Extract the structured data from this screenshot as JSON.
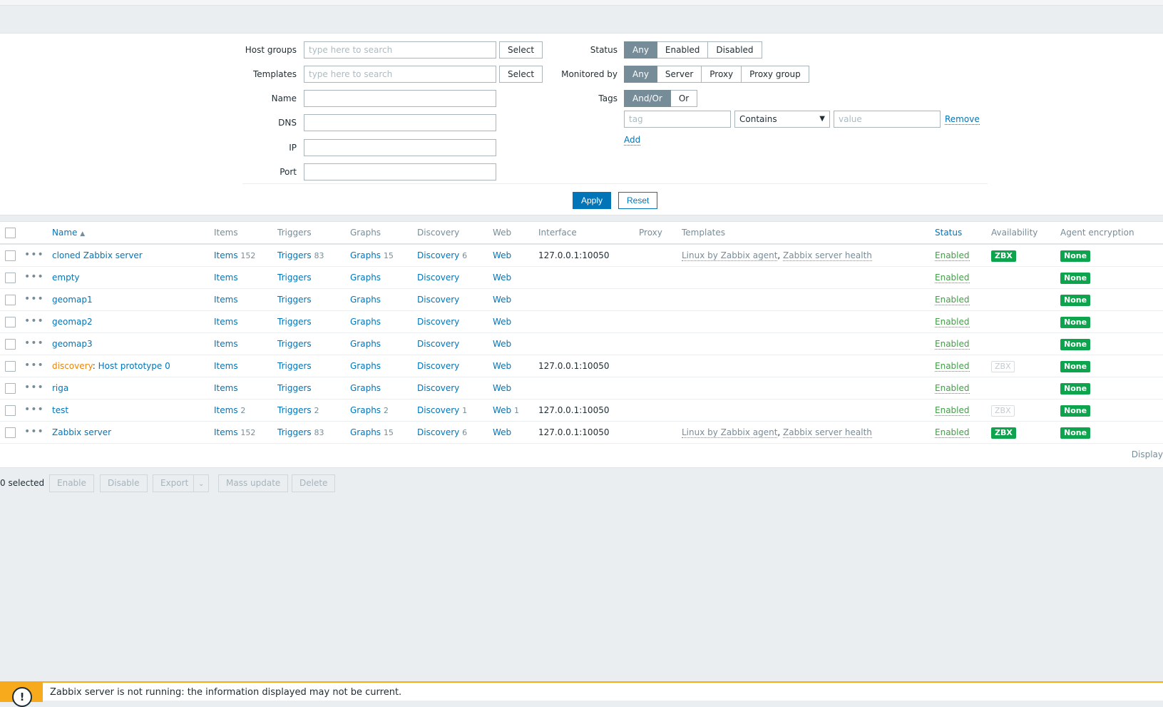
{
  "filter": {
    "host_groups_label": "Host groups",
    "host_groups_placeholder": "type here to search",
    "templates_label": "Templates",
    "templates_placeholder": "type here to search",
    "select_label": "Select",
    "name_label": "Name",
    "dns_label": "DNS",
    "ip_label": "IP",
    "port_label": "Port",
    "status_label": "Status",
    "status_options": [
      "Any",
      "Enabled",
      "Disabled"
    ],
    "monitored_label": "Monitored by",
    "monitored_options": [
      "Any",
      "Server",
      "Proxy",
      "Proxy group"
    ],
    "tags_label": "Tags",
    "tags_options": [
      "And/Or",
      "Or"
    ],
    "tag_placeholder": "tag",
    "operator_value": "Contains",
    "value_placeholder": "value",
    "remove_label": "Remove",
    "add_label": "Add",
    "apply_label": "Apply",
    "reset_label": "Reset"
  },
  "table": {
    "headers": {
      "name": "Name",
      "items": "Items",
      "triggers": "Triggers",
      "graphs": "Graphs",
      "discovery": "Discovery",
      "web": "Web",
      "interface": "Interface",
      "proxy": "Proxy",
      "templates": "Templates",
      "status": "Status",
      "availability": "Availability",
      "encryption": "Agent encryption"
    },
    "rows": [
      {
        "prefix": "",
        "name": "cloned Zabbix server",
        "items": "Items",
        "items_count": "152",
        "triggers": "Triggers",
        "triggers_count": "83",
        "graphs": "Graphs",
        "graphs_count": "15",
        "discovery": "Discovery",
        "discovery_count": "6",
        "web": "Web",
        "web_count": "",
        "interface": "127.0.0.1:10050",
        "tpl1": "Linux by Zabbix agent",
        "tpl2": "Zabbix server health",
        "status": "Enabled",
        "avail": "ZBX",
        "avail_state": "green",
        "enc": "None"
      },
      {
        "prefix": "",
        "name": "empty",
        "items": "Items",
        "items_count": "",
        "triggers": "Triggers",
        "triggers_count": "",
        "graphs": "Graphs",
        "graphs_count": "",
        "discovery": "Discovery",
        "discovery_count": "",
        "web": "Web",
        "web_count": "",
        "interface": "",
        "tpl1": "",
        "tpl2": "",
        "status": "Enabled",
        "avail": "",
        "avail_state": "",
        "enc": "None"
      },
      {
        "prefix": "",
        "name": "geomap1",
        "items": "Items",
        "items_count": "",
        "triggers": "Triggers",
        "triggers_count": "",
        "graphs": "Graphs",
        "graphs_count": "",
        "discovery": "Discovery",
        "discovery_count": "",
        "web": "Web",
        "web_count": "",
        "interface": "",
        "tpl1": "",
        "tpl2": "",
        "status": "Enabled",
        "avail": "",
        "avail_state": "",
        "enc": "None"
      },
      {
        "prefix": "",
        "name": "geomap2",
        "items": "Items",
        "items_count": "",
        "triggers": "Triggers",
        "triggers_count": "",
        "graphs": "Graphs",
        "graphs_count": "",
        "discovery": "Discovery",
        "discovery_count": "",
        "web": "Web",
        "web_count": "",
        "interface": "",
        "tpl1": "",
        "tpl2": "",
        "status": "Enabled",
        "avail": "",
        "avail_state": "",
        "enc": "None"
      },
      {
        "prefix": "",
        "name": "geomap3",
        "items": "Items",
        "items_count": "",
        "triggers": "Triggers",
        "triggers_count": "",
        "graphs": "Graphs",
        "graphs_count": "",
        "discovery": "Discovery",
        "discovery_count": "",
        "web": "Web",
        "web_count": "",
        "interface": "",
        "tpl1": "",
        "tpl2": "",
        "status": "Enabled",
        "avail": "",
        "avail_state": "",
        "enc": "None"
      },
      {
        "prefix": "discovery",
        "name": "Host prototype 0",
        "items": "Items",
        "items_count": "",
        "triggers": "Triggers",
        "triggers_count": "",
        "graphs": "Graphs",
        "graphs_count": "",
        "discovery": "Discovery",
        "discovery_count": "",
        "web": "Web",
        "web_count": "",
        "interface": "127.0.0.1:10050",
        "tpl1": "",
        "tpl2": "",
        "status": "Enabled",
        "avail": "ZBX",
        "avail_state": "gray",
        "enc": "None"
      },
      {
        "prefix": "",
        "name": "riga",
        "items": "Items",
        "items_count": "",
        "triggers": "Triggers",
        "triggers_count": "",
        "graphs": "Graphs",
        "graphs_count": "",
        "discovery": "Discovery",
        "discovery_count": "",
        "web": "Web",
        "web_count": "",
        "interface": "",
        "tpl1": "",
        "tpl2": "",
        "status": "Enabled",
        "avail": "",
        "avail_state": "",
        "enc": "None"
      },
      {
        "prefix": "",
        "name": "test",
        "items": "Items",
        "items_count": "2",
        "triggers": "Triggers",
        "triggers_count": "2",
        "graphs": "Graphs",
        "graphs_count": "2",
        "discovery": "Discovery",
        "discovery_count": "1",
        "web": "Web",
        "web_count": "1",
        "interface": "127.0.0.1:10050",
        "tpl1": "",
        "tpl2": "",
        "status": "Enabled",
        "avail": "ZBX",
        "avail_state": "gray",
        "enc": "None"
      },
      {
        "prefix": "",
        "name": "Zabbix server",
        "items": "Items",
        "items_count": "152",
        "triggers": "Triggers",
        "triggers_count": "83",
        "graphs": "Graphs",
        "graphs_count": "15",
        "discovery": "Discovery",
        "discovery_count": "6",
        "web": "Web",
        "web_count": "",
        "interface": "127.0.0.1:10050",
        "tpl1": "Linux by Zabbix agent",
        "tpl2": "Zabbix server health",
        "status": "Enabled",
        "avail": "ZBX",
        "avail_state": "green",
        "enc": "None"
      }
    ],
    "display_text": "Display"
  },
  "actions": {
    "selected": "0 selected",
    "enable": "Enable",
    "disable": "Disable",
    "export": "Export",
    "mass_update": "Mass update",
    "delete": "Delete"
  },
  "warning": {
    "icon": "!",
    "message": "Zabbix server is not running: the information displayed may not be current."
  }
}
